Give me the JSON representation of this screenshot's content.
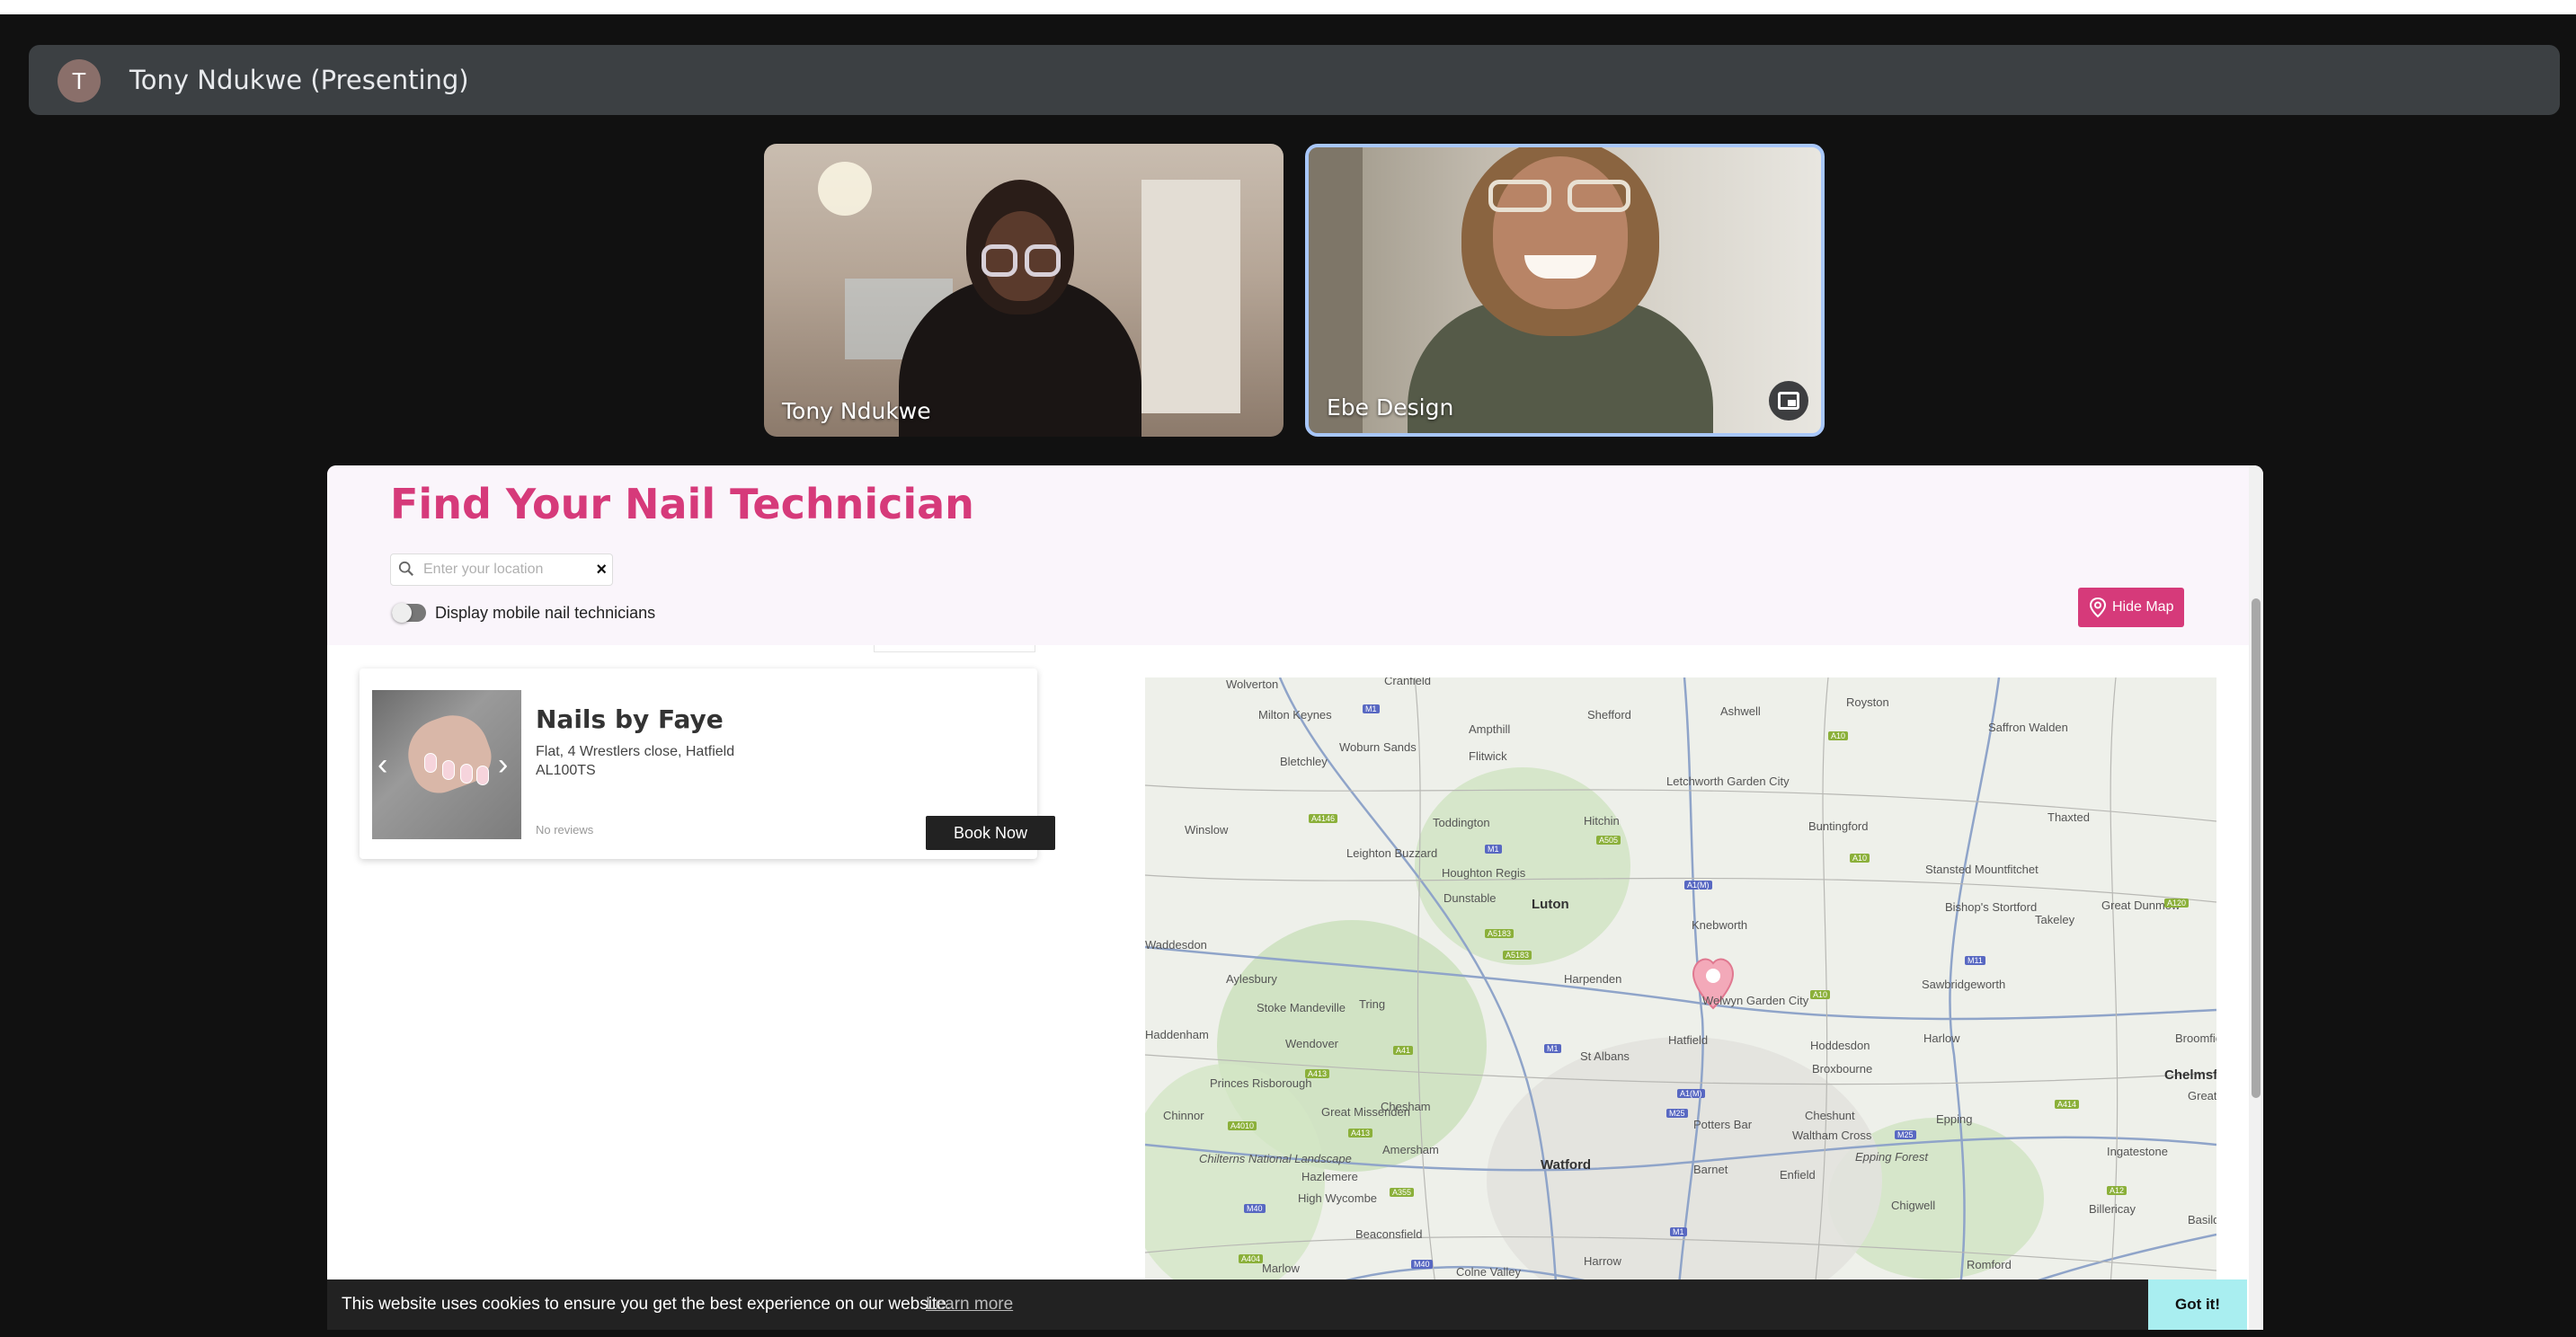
{
  "meet": {
    "presenter_initial": "T",
    "presenter_label": "Tony Ndukwe (Presenting)",
    "participants": [
      {
        "name": "Tony Ndukwe"
      },
      {
        "name": "Ebe Design"
      }
    ],
    "icons": {
      "pip": "picture-in-picture-icon"
    }
  },
  "site": {
    "title": "Find Your Nail Technician",
    "search": {
      "placeholder": "Enter your location",
      "value": ""
    },
    "mobile_toggle_label": "Display mobile nail technicians",
    "hide_map_label": "Hide Map",
    "card": {
      "name": "Nails by Faye",
      "address_line1": "Flat, 4 Wrestlers close, Hatfield",
      "address_line2": "AL100TS",
      "reviews": "No reviews",
      "book_label": "Book Now"
    },
    "map_labels": [
      "Wolverton",
      "Cranfield",
      "Milton Keynes",
      "Ampthill",
      "Shefford",
      "Ashwell",
      "Royston",
      "Saffron Walden",
      "Woburn Sands",
      "Bletchley",
      "Flitwick",
      "Letchworth Garden City",
      "Winslow",
      "Toddington",
      "Hitchin",
      "Buntingford",
      "Thaxted",
      "Leighton Buzzard",
      "Houghton Regis",
      "Dunstable",
      "Luton",
      "Stansted Mountfitchet",
      "Bishop's Stortford",
      "Takeley",
      "Great Dunmow",
      "Waddesdon",
      "Knebworth",
      "Aylesbury",
      "Harpenden",
      "Sawbridgeworth",
      "Tring",
      "Stoke Mandeville",
      "Haddenham",
      "Hatfield",
      "Hoddesdon",
      "Harlow",
      "Broomfield",
      "Wendover",
      "St Albans",
      "Broxbourne",
      "Chelmsford",
      "Princes Risborough",
      "Great Missenden",
      "Chesham",
      "Potters Bar",
      "Cheshunt",
      "Waltham Cross",
      "Epping",
      "Chinnor",
      "Amersham",
      "Ingatestone",
      "Chilterns National Landscape",
      "Hazlemere",
      "Watford",
      "Barnet",
      "Enfield",
      "Epping Forest",
      "High Wycombe",
      "Chigwell",
      "Billericay",
      "Beaconsfield",
      "Marlow",
      "Colne Valley",
      "Harrow",
      "Romford",
      "Welwyn Garden City",
      "Great",
      "Basildon"
    ],
    "colors": {
      "brand_pink": "#d63a7a",
      "cookie_button": "#a9eef0"
    }
  },
  "cookie": {
    "text": "This website uses cookies to ensure you get the best experience on our website.",
    "link": "Learn more",
    "button": "Got it!"
  }
}
